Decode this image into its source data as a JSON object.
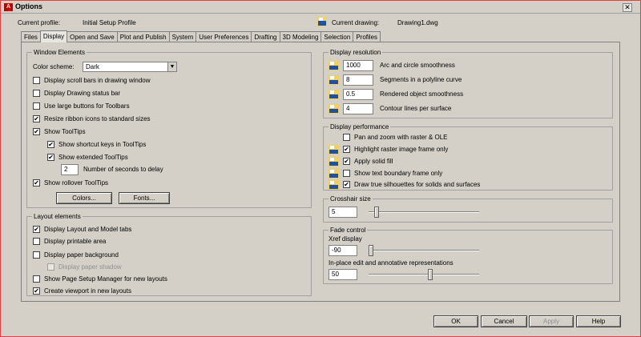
{
  "window": {
    "title": "Options",
    "close_glyph": "✕",
    "app_icon_letter": "A"
  },
  "profile": {
    "current_profile_label": "Current profile:",
    "current_profile_value": "Initial Setup Profile",
    "current_drawing_label": "Current drawing:",
    "current_drawing_value": "Drawing1.dwg"
  },
  "tabs": [
    "Files",
    "Display",
    "Open and Save",
    "Plot and Publish",
    "System",
    "User Preferences",
    "Drafting",
    "3D Modeling",
    "Selection",
    "Profiles"
  ],
  "active_tab": "Display",
  "window_elements": {
    "title": "Window Elements",
    "color_scheme_label": "Color scheme:",
    "color_scheme_value": "Dark",
    "checkboxes": [
      {
        "label": "Display scroll bars in drawing window",
        "checked": false
      },
      {
        "label": "Display Drawing status bar",
        "checked": false
      },
      {
        "label": "Use large buttons for Toolbars",
        "checked": false
      },
      {
        "label": "Resize ribbon icons to standard sizes",
        "checked": true
      },
      {
        "label": "Show ToolTips",
        "checked": true
      },
      {
        "label": "Show shortcut keys in ToolTips",
        "checked": true
      },
      {
        "label": "Show extended ToolTips",
        "checked": true
      }
    ],
    "delay_value": "2",
    "delay_label": "Number of seconds to delay",
    "rollover_label": "Show rollover ToolTips",
    "rollover_checked": true,
    "colors_button": "Colors...",
    "fonts_button": "Fonts..."
  },
  "layout_elements": {
    "title": "Layout elements",
    "checkboxes": [
      {
        "label": "Display Layout and Model tabs",
        "checked": true,
        "disabled": false
      },
      {
        "label": "Display printable area",
        "checked": false,
        "disabled": false
      },
      {
        "label": "Display paper background",
        "checked": false,
        "disabled": false
      },
      {
        "label": "Display paper shadow",
        "checked": false,
        "disabled": true
      },
      {
        "label": "Show Page Setup Manager for new layouts",
        "checked": false,
        "disabled": false
      },
      {
        "label": "Create viewport in new layouts",
        "checked": true,
        "disabled": false
      }
    ]
  },
  "display_resolution": {
    "title": "Display resolution",
    "items": [
      {
        "value": "1000",
        "label": "Arc and circle smoothness"
      },
      {
        "value": "8",
        "label": "Segments in a polyline curve"
      },
      {
        "value": "0.5",
        "label": "Rendered object smoothness"
      },
      {
        "value": "4",
        "label": "Contour lines per surface"
      }
    ]
  },
  "display_performance": {
    "title": "Display performance",
    "items": [
      {
        "label": "Pan and zoom with raster & OLE",
        "checked": false,
        "icon": false
      },
      {
        "label": "Highlight raster image frame only",
        "checked": true,
        "icon": true
      },
      {
        "label": "Apply solid fill",
        "checked": true,
        "icon": true
      },
      {
        "label": "Show text boundary frame only",
        "checked": false,
        "icon": true
      },
      {
        "label": "Draw true silhouettes for solids and surfaces",
        "checked": true,
        "icon": true
      }
    ]
  },
  "crosshair": {
    "title": "Crosshair size",
    "value": "5",
    "fraction": 0.05
  },
  "fade": {
    "title": "Fade control",
    "xref_label": "Xref display",
    "xref_value": "-90",
    "xref_fraction": 0.0,
    "inplace_label": "In-place edit and annotative representations",
    "inplace_value": "50",
    "inplace_fraction": 0.56
  },
  "buttons": {
    "ok": "OK",
    "cancel": "Cancel",
    "apply": "Apply",
    "help": "Help"
  },
  "check_glyph": "✔",
  "colors": {
    "frame_border": "#e04040",
    "dialog_bg": "#d4d0c8",
    "app_icon": "#c00000"
  }
}
